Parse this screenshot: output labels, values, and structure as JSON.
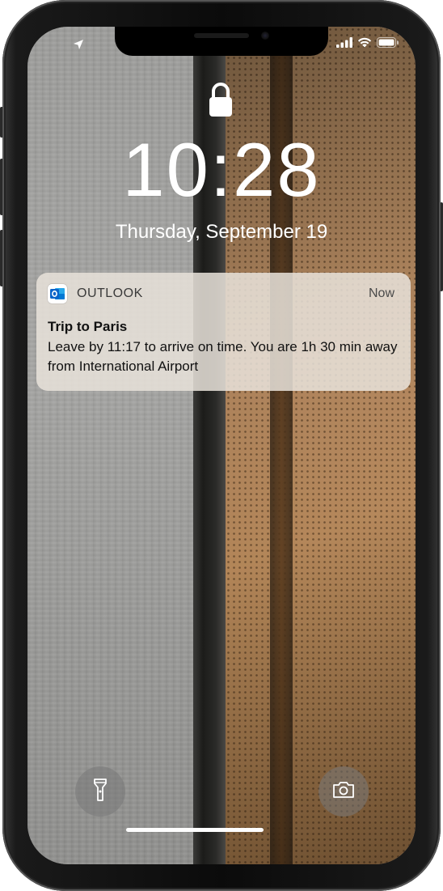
{
  "status_bar": {
    "location_icon": "location-arrow-icon",
    "signal_icon": "cellular-signal-icon",
    "wifi_icon": "wifi-icon",
    "battery_icon": "battery-icon"
  },
  "lock_screen": {
    "lock_icon": "lock-icon",
    "time": "10:28",
    "date": "Thursday, September 19"
  },
  "notification": {
    "app_icon": "outlook-icon",
    "app_name": "OUTLOOK",
    "timestamp": "Now",
    "title": "Trip to Paris",
    "body": "Leave by 11:17 to arrive on time. You are 1h 30 min away from International Airport"
  },
  "quick_actions": {
    "flashlight_icon": "flashlight-icon",
    "camera_icon": "camera-icon"
  },
  "colors": {
    "outlook_blue": "#0a64c9",
    "notification_bg": "#e8e2da"
  }
}
